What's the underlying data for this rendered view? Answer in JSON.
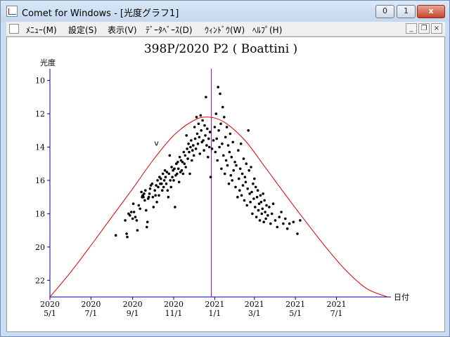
{
  "window": {
    "title": "Comet for Windows - [光度グラフ1]",
    "buttons": {
      "minimize": "0",
      "maximize": "1",
      "close": "x"
    }
  },
  "menubar": {
    "items": [
      "ﾒﾆｭｰ(M)",
      "設定(S)",
      "表示(V)",
      "ﾃﾞｰﾀﾍﾞｰｽ(D)",
      "ｳｨﾝﾄﾞｳ(W)",
      "ﾍﾙﾌﾟ(H)"
    ],
    "mdi_buttons": {
      "minimize": "_",
      "restore": "❐",
      "close": "×"
    }
  },
  "colors": {
    "axis": "#0000aa",
    "curve": "#e00000",
    "marker": "#a000c0",
    "points": "#000000"
  },
  "chart_data": {
    "type": "scatter",
    "title": "398P/2020 P2 ( Boattini )",
    "ylabel": "光度",
    "xlabel": "日付",
    "y_inverted": true,
    "ylim": [
      23,
      9.3
    ],
    "y_ticks": [
      "10",
      "12",
      "14",
      "16",
      "18",
      "20",
      "22"
    ],
    "x_ticks": [
      {
        "year": "2020",
        "md": "5/1"
      },
      {
        "year": "2020",
        "md": "7/1"
      },
      {
        "year": "2020",
        "md": "9/1"
      },
      {
        "year": "2020",
        "md": "11/1"
      },
      {
        "year": "2021",
        "md": "1/1"
      },
      {
        "year": "2021",
        "md": "3/1"
      },
      {
        "year": "2021",
        "md": "5/1"
      },
      {
        "year": "2021",
        "md": "7/1"
      }
    ],
    "xlim": [
      "2020-05-01",
      "2021-09-20"
    ],
    "perihelion_date": "2020-12-27",
    "annotation": "v",
    "annotation_point": [
      "2020-10-03",
      14.0
    ],
    "fit_curve": {
      "peak_date": "2020-12-22",
      "peak_magnitude": 12.2,
      "points": [
        [
          "2020-05-01",
          23.0
        ],
        [
          "2020-06-01",
          21.5
        ],
        [
          "2020-07-01",
          19.9
        ],
        [
          "2020-08-01",
          18.2
        ],
        [
          "2020-09-01",
          16.5
        ],
        [
          "2020-10-01",
          14.8
        ],
        [
          "2020-11-01",
          13.3
        ],
        [
          "2020-12-01",
          12.4
        ],
        [
          "2020-12-22",
          12.2
        ],
        [
          "2021-01-15",
          12.5
        ],
        [
          "2021-02-15",
          13.6
        ],
        [
          "2021-03-15",
          15.1
        ],
        [
          "2021-04-15",
          16.8
        ],
        [
          "2021-05-15",
          18.4
        ],
        [
          "2021-06-15",
          20.0
        ],
        [
          "2021-07-15",
          21.4
        ],
        [
          "2021-08-15",
          22.5
        ],
        [
          "2021-09-15",
          23.0
        ]
      ]
    },
    "observations": [
      [
        "2020-08-07",
        19.3
      ],
      [
        "2020-08-21",
        18.4
      ],
      [
        "2020-08-23",
        19.2
      ],
      [
        "2020-08-24",
        19.4
      ],
      [
        "2020-08-26",
        18.0
      ],
      [
        "2020-08-28",
        18.1
      ],
      [
        "2020-08-30",
        17.9
      ],
      [
        "2020-09-01",
        18.3
      ],
      [
        "2020-09-02",
        17.4
      ],
      [
        "2020-09-03",
        17.9
      ],
      [
        "2020-09-05",
        18.2
      ],
      [
        "2020-09-07",
        18.4
      ],
      [
        "2020-09-08",
        19.0
      ],
      [
        "2020-09-10",
        17.5
      ],
      [
        "2020-09-12",
        17.7
      ],
      [
        "2020-09-14",
        16.7
      ],
      [
        "2020-09-15",
        17.0
      ],
      [
        "2020-09-16",
        16.9
      ],
      [
        "2020-09-17",
        17.0
      ],
      [
        "2020-09-18",
        16.8
      ],
      [
        "2020-09-19",
        17.2
      ],
      [
        "2020-09-20",
        16.6
      ],
      [
        "2020-09-21",
        17.8
      ],
      [
        "2020-09-22",
        18.8
      ],
      [
        "2020-09-23",
        18.5
      ],
      [
        "2020-09-24",
        17.1
      ],
      [
        "2020-09-25",
        17.0
      ],
      [
        "2020-09-26",
        16.8
      ],
      [
        "2020-09-27",
        16.5
      ],
      [
        "2020-09-28",
        16.3
      ],
      [
        "2020-09-30",
        16.2
      ],
      [
        "2020-10-01",
        17.0
      ],
      [
        "2020-10-02",
        17.6
      ],
      [
        "2020-10-04",
        16.6
      ],
      [
        "2020-10-05",
        16.9
      ],
      [
        "2020-10-06",
        16.3
      ],
      [
        "2020-10-07",
        17.3
      ],
      [
        "2020-10-08",
        16.0
      ],
      [
        "2020-10-09",
        16.4
      ],
      [
        "2020-10-10",
        16.9
      ],
      [
        "2020-10-11",
        15.8
      ],
      [
        "2020-10-12",
        16.2
      ],
      [
        "2020-10-13",
        15.9
      ],
      [
        "2020-10-14",
        16.2
      ],
      [
        "2020-10-15",
        16.6
      ],
      [
        "2020-10-16",
        15.6
      ],
      [
        "2020-10-17",
        16.4
      ],
      [
        "2020-10-18",
        16.0
      ],
      [
        "2020-10-19",
        15.4
      ],
      [
        "2020-10-20",
        15.8
      ],
      [
        "2020-10-21",
        16.2
      ],
      [
        "2020-10-22",
        15.5
      ],
      [
        "2020-10-23",
        16.6
      ],
      [
        "2020-10-24",
        17.0
      ],
      [
        "2020-10-25",
        15.6
      ],
      [
        "2020-10-26",
        14.5
      ],
      [
        "2020-10-27",
        16.0
      ],
      [
        "2020-10-28",
        16.4
      ],
      [
        "2020-10-29",
        15.2
      ],
      [
        "2020-10-30",
        15.8
      ],
      [
        "2020-10-31",
        15.4
      ],
      [
        "2020-11-01",
        16.0
      ],
      [
        "2020-11-02",
        15.3
      ],
      [
        "2020-11-03",
        17.6
      ],
      [
        "2020-11-04",
        15.7
      ],
      [
        "2020-11-05",
        15.0
      ],
      [
        "2020-11-06",
        15.6
      ],
      [
        "2020-11-07",
        14.9
      ],
      [
        "2020-11-08",
        15.3
      ],
      [
        "2020-11-09",
        16.1
      ],
      [
        "2020-11-10",
        14.6
      ],
      [
        "2020-11-11",
        15.5
      ],
      [
        "2020-11-12",
        14.8
      ],
      [
        "2020-11-13",
        15.4
      ],
      [
        "2020-11-14",
        14.9
      ],
      [
        "2020-11-15",
        15.6
      ],
      [
        "2020-11-16",
        14.3
      ],
      [
        "2020-11-17",
        15.0
      ],
      [
        "2020-11-18",
        14.5
      ],
      [
        "2020-11-19",
        15.2
      ],
      [
        "2020-11-20",
        13.3
      ],
      [
        "2020-11-21",
        14.1
      ],
      [
        "2020-11-22",
        14.7
      ],
      [
        "2020-11-23",
        13.8
      ],
      [
        "2020-11-24",
        14.3
      ],
      [
        "2020-11-25",
        15.6
      ],
      [
        "2020-11-26",
        14.0
      ],
      [
        "2020-11-27",
        13.6
      ],
      [
        "2020-11-28",
        14.8
      ],
      [
        "2020-11-29",
        14.2
      ],
      [
        "2020-11-30",
        13.9
      ],
      [
        "2020-12-01",
        14.5
      ],
      [
        "2020-12-02",
        12.8
      ],
      [
        "2020-12-03",
        13.5
      ],
      [
        "2020-12-04",
        14.1
      ],
      [
        "2020-12-05",
        12.2
      ],
      [
        "2020-12-06",
        13.2
      ],
      [
        "2020-12-07",
        13.8
      ],
      [
        "2020-12-08",
        12.6
      ],
      [
        "2020-12-09",
        13.4
      ],
      [
        "2020-12-10",
        14.4
      ],
      [
        "2020-12-11",
        12.1
      ],
      [
        "2020-12-12",
        13.0
      ],
      [
        "2020-12-13",
        13.7
      ],
      [
        "2020-12-14",
        12.4
      ],
      [
        "2020-12-15",
        13.6
      ],
      [
        "2020-12-16",
        14.2
      ],
      [
        "2020-12-17",
        12.7
      ],
      [
        "2020-12-18",
        13.3
      ],
      [
        "2020-12-19",
        11.0
      ],
      [
        "2020-12-20",
        13.9
      ],
      [
        "2020-12-21",
        12.9
      ],
      [
        "2020-12-22",
        14.6
      ],
      [
        "2020-12-23",
        13.5
      ],
      [
        "2020-12-24",
        14.0
      ],
      [
        "2020-12-25",
        13.1
      ],
      [
        "2020-12-26",
        15.8
      ],
      [
        "2020-12-28",
        14.1
      ],
      [
        "2020-12-30",
        13.6
      ],
      [
        "2021-01-01",
        12.8
      ],
      [
        "2021-01-02",
        14.3
      ],
      [
        "2021-01-03",
        12.0
      ],
      [
        "2021-01-04",
        13.5
      ],
      [
        "2021-01-05",
        14.8
      ],
      [
        "2021-01-06",
        10.4
      ],
      [
        "2021-01-07",
        13.0
      ],
      [
        "2021-01-08",
        14.0
      ],
      [
        "2021-01-09",
        10.8
      ],
      [
        "2021-01-10",
        12.6
      ],
      [
        "2021-01-11",
        15.3
      ],
      [
        "2021-01-12",
        13.8
      ],
      [
        "2021-01-13",
        11.6
      ],
      [
        "2021-01-14",
        14.5
      ],
      [
        "2021-01-15",
        12.2
      ],
      [
        "2021-01-16",
        15.6
      ],
      [
        "2021-01-17",
        13.4
      ],
      [
        "2021-01-18",
        14.8
      ],
      [
        "2021-01-19",
        12.8
      ],
      [
        "2021-01-20",
        15.1
      ],
      [
        "2021-01-21",
        13.9
      ],
      [
        "2021-01-22",
        16.2
      ],
      [
        "2021-01-23",
        14.3
      ],
      [
        "2021-01-24",
        13.2
      ],
      [
        "2021-01-25",
        15.7
      ],
      [
        "2021-01-26",
        14.6
      ],
      [
        "2021-01-27",
        16.0
      ],
      [
        "2021-01-28",
        13.7
      ],
      [
        "2021-01-29",
        15.4
      ],
      [
        "2021-01-31",
        14.9
      ],
      [
        "2021-02-01",
        16.4
      ],
      [
        "2021-02-02",
        15.1
      ],
      [
        "2021-02-04",
        17.0
      ],
      [
        "2021-02-05",
        14.2
      ],
      [
        "2021-02-06",
        15.9
      ],
      [
        "2021-02-07",
        16.6
      ],
      [
        "2021-02-08",
        15.3
      ],
      [
        "2021-02-09",
        13.8
      ],
      [
        "2021-02-10",
        16.9
      ],
      [
        "2021-02-11",
        15.6
      ],
      [
        "2021-02-12",
        16.3
      ],
      [
        "2021-02-13",
        14.7
      ],
      [
        "2021-02-14",
        17.2
      ],
      [
        "2021-02-15",
        15.8
      ],
      [
        "2021-02-16",
        16.1
      ],
      [
        "2021-02-17",
        15.0
      ],
      [
        "2021-02-18",
        17.5
      ],
      [
        "2021-02-19",
        16.5
      ],
      [
        "2021-02-20",
        13.0
      ],
      [
        "2021-02-21",
        15.4
      ],
      [
        "2021-02-22",
        16.8
      ],
      [
        "2021-02-23",
        17.3
      ],
      [
        "2021-02-24",
        15.2
      ],
      [
        "2021-02-25",
        16.7
      ],
      [
        "2021-02-26",
        18.0
      ],
      [
        "2021-02-27",
        16.2
      ],
      [
        "2021-02-28",
        17.1
      ],
      [
        "2021-03-01",
        15.9
      ],
      [
        "2021-03-02",
        17.6
      ],
      [
        "2021-03-03",
        16.4
      ],
      [
        "2021-03-04",
        18.2
      ],
      [
        "2021-03-05",
        17.0
      ],
      [
        "2021-03-06",
        16.6
      ],
      [
        "2021-03-07",
        17.8
      ],
      [
        "2021-03-08",
        17.4
      ],
      [
        "2021-03-09",
        18.4
      ],
      [
        "2021-03-10",
        16.9
      ],
      [
        "2021-03-11",
        17.3
      ],
      [
        "2021-03-12",
        18.0
      ],
      [
        "2021-03-13",
        17.7
      ],
      [
        "2021-03-14",
        16.8
      ],
      [
        "2021-03-15",
        18.5
      ],
      [
        "2021-03-16",
        17.2
      ],
      [
        "2021-03-17",
        17.9
      ],
      [
        "2021-03-18",
        18.3
      ],
      [
        "2021-03-19",
        17.5
      ],
      [
        "2021-03-21",
        18.1
      ],
      [
        "2021-03-23",
        17.6
      ],
      [
        "2021-03-25",
        18.6
      ],
      [
        "2021-03-27",
        18.0
      ],
      [
        "2021-03-29",
        17.4
      ],
      [
        "2021-04-01",
        18.4
      ],
      [
        "2021-04-04",
        18.8
      ],
      [
        "2021-04-07",
        18.2
      ],
      [
        "2021-04-10",
        17.9
      ],
      [
        "2021-04-13",
        18.6
      ],
      [
        "2021-04-16",
        18.3
      ],
      [
        "2021-04-19",
        18.9
      ],
      [
        "2021-04-22",
        18.6
      ],
      [
        "2021-04-28",
        18.5
      ],
      [
        "2021-05-04",
        19.2
      ],
      [
        "2021-05-08",
        18.4
      ]
    ]
  }
}
